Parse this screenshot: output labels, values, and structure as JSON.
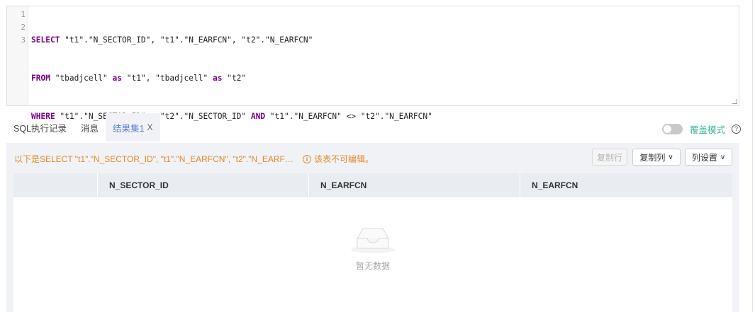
{
  "editor": {
    "line_numbers": [
      "1",
      "2",
      "3"
    ],
    "line1": {
      "kw1": "SELECT",
      "rest": " \"t1\".\"N_SECTOR_ID\", \"t1\".\"N_EARFCN\", \"t2\".\"N_EARFCN\""
    },
    "line2": {
      "kw1": "FROM",
      "a": " \"tbadjcell\" ",
      "kw2": "as",
      "b": " \"t1\", \"tbadjcell\" ",
      "kw3": "as",
      "c": " \"t2\""
    },
    "line3": {
      "kw1": "WHERE",
      "a": " \"t1\".\"N_SECTOR_ID\" = \"t2\".\"N_SECTOR_ID\" ",
      "kw2": "AND",
      "b": " \"t1\".\"N_EARFCN\" <> \"t2\".\"N_EARFCN\""
    }
  },
  "tabs": {
    "history": "SQL执行记录",
    "messages": "消息",
    "result": "结果集1",
    "close": "X"
  },
  "overlay_mode": {
    "label": "覆盖模式",
    "enabled": false,
    "help": "?"
  },
  "result": {
    "notice": "以下是SELECT \"t1\".\"N_SECTOR_ID\", \"t1\".\"N_EARFCN\", \"t2\".\"N_EARF…",
    "readonly_warning": "该表不可编辑。",
    "copy_row": "复制行",
    "copy_column": "复制列",
    "column_settings": "列设置",
    "columns": [
      "N_SECTOR_ID",
      "N_EARFCN",
      "N_EARFCN"
    ],
    "empty_text": "暂无数据"
  },
  "colors": {
    "accent": "#5b7fe0",
    "warning": "#e08a2e",
    "toggle_label": "#3cb39c",
    "keyword": "#770088"
  }
}
